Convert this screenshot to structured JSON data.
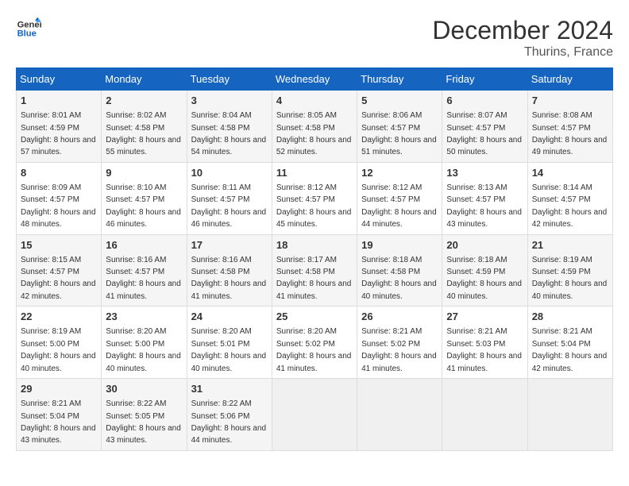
{
  "logo": {
    "line1": "General",
    "line2": "Blue"
  },
  "title": "December 2024",
  "location": "Thurins, France",
  "weekdays": [
    "Sunday",
    "Monday",
    "Tuesday",
    "Wednesday",
    "Thursday",
    "Friday",
    "Saturday"
  ],
  "weeks": [
    [
      {
        "day": "1",
        "sunrise": "8:01 AM",
        "sunset": "4:59 PM",
        "daylight": "8 hours and 57 minutes."
      },
      {
        "day": "2",
        "sunrise": "8:02 AM",
        "sunset": "4:58 PM",
        "daylight": "8 hours and 55 minutes."
      },
      {
        "day": "3",
        "sunrise": "8:04 AM",
        "sunset": "4:58 PM",
        "daylight": "8 hours and 54 minutes."
      },
      {
        "day": "4",
        "sunrise": "8:05 AM",
        "sunset": "4:58 PM",
        "daylight": "8 hours and 52 minutes."
      },
      {
        "day": "5",
        "sunrise": "8:06 AM",
        "sunset": "4:57 PM",
        "daylight": "8 hours and 51 minutes."
      },
      {
        "day": "6",
        "sunrise": "8:07 AM",
        "sunset": "4:57 PM",
        "daylight": "8 hours and 50 minutes."
      },
      {
        "day": "7",
        "sunrise": "8:08 AM",
        "sunset": "4:57 PM",
        "daylight": "8 hours and 49 minutes."
      }
    ],
    [
      {
        "day": "8",
        "sunrise": "8:09 AM",
        "sunset": "4:57 PM",
        "daylight": "8 hours and 48 minutes."
      },
      {
        "day": "9",
        "sunrise": "8:10 AM",
        "sunset": "4:57 PM",
        "daylight": "8 hours and 46 minutes."
      },
      {
        "day": "10",
        "sunrise": "8:11 AM",
        "sunset": "4:57 PM",
        "daylight": "8 hours and 46 minutes."
      },
      {
        "day": "11",
        "sunrise": "8:12 AM",
        "sunset": "4:57 PM",
        "daylight": "8 hours and 45 minutes."
      },
      {
        "day": "12",
        "sunrise": "8:12 AM",
        "sunset": "4:57 PM",
        "daylight": "8 hours and 44 minutes."
      },
      {
        "day": "13",
        "sunrise": "8:13 AM",
        "sunset": "4:57 PM",
        "daylight": "8 hours and 43 minutes."
      },
      {
        "day": "14",
        "sunrise": "8:14 AM",
        "sunset": "4:57 PM",
        "daylight": "8 hours and 42 minutes."
      }
    ],
    [
      {
        "day": "15",
        "sunrise": "8:15 AM",
        "sunset": "4:57 PM",
        "daylight": "8 hours and 42 minutes."
      },
      {
        "day": "16",
        "sunrise": "8:16 AM",
        "sunset": "4:57 PM",
        "daylight": "8 hours and 41 minutes."
      },
      {
        "day": "17",
        "sunrise": "8:16 AM",
        "sunset": "4:58 PM",
        "daylight": "8 hours and 41 minutes."
      },
      {
        "day": "18",
        "sunrise": "8:17 AM",
        "sunset": "4:58 PM",
        "daylight": "8 hours and 41 minutes."
      },
      {
        "day": "19",
        "sunrise": "8:18 AM",
        "sunset": "4:58 PM",
        "daylight": "8 hours and 40 minutes."
      },
      {
        "day": "20",
        "sunrise": "8:18 AM",
        "sunset": "4:59 PM",
        "daylight": "8 hours and 40 minutes."
      },
      {
        "day": "21",
        "sunrise": "8:19 AM",
        "sunset": "4:59 PM",
        "daylight": "8 hours and 40 minutes."
      }
    ],
    [
      {
        "day": "22",
        "sunrise": "8:19 AM",
        "sunset": "5:00 PM",
        "daylight": "8 hours and 40 minutes."
      },
      {
        "day": "23",
        "sunrise": "8:20 AM",
        "sunset": "5:00 PM",
        "daylight": "8 hours and 40 minutes."
      },
      {
        "day": "24",
        "sunrise": "8:20 AM",
        "sunset": "5:01 PM",
        "daylight": "8 hours and 40 minutes."
      },
      {
        "day": "25",
        "sunrise": "8:20 AM",
        "sunset": "5:02 PM",
        "daylight": "8 hours and 41 minutes."
      },
      {
        "day": "26",
        "sunrise": "8:21 AM",
        "sunset": "5:02 PM",
        "daylight": "8 hours and 41 minutes."
      },
      {
        "day": "27",
        "sunrise": "8:21 AM",
        "sunset": "5:03 PM",
        "daylight": "8 hours and 41 minutes."
      },
      {
        "day": "28",
        "sunrise": "8:21 AM",
        "sunset": "5:04 PM",
        "daylight": "8 hours and 42 minutes."
      }
    ],
    [
      {
        "day": "29",
        "sunrise": "8:21 AM",
        "sunset": "5:04 PM",
        "daylight": "8 hours and 43 minutes."
      },
      {
        "day": "30",
        "sunrise": "8:22 AM",
        "sunset": "5:05 PM",
        "daylight": "8 hours and 43 minutes."
      },
      {
        "day": "31",
        "sunrise": "8:22 AM",
        "sunset": "5:06 PM",
        "daylight": "8 hours and 44 minutes."
      },
      null,
      null,
      null,
      null
    ]
  ]
}
